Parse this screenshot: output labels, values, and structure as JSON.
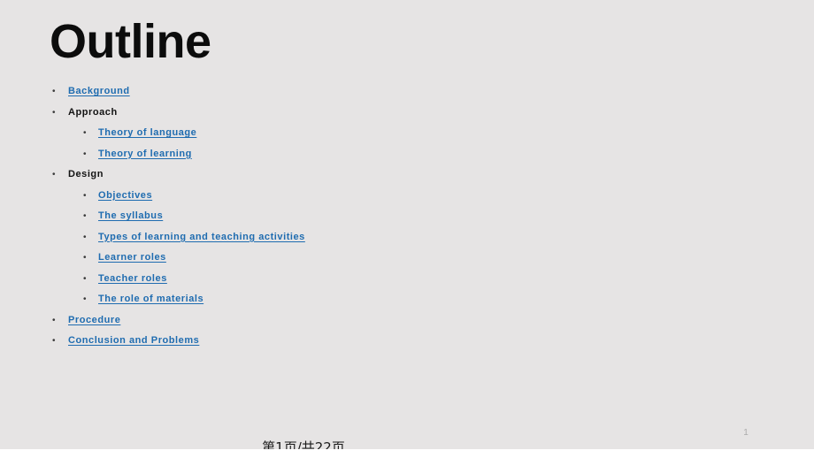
{
  "slide": {
    "title": "Outline",
    "background_color": "#e6e4e4",
    "title_color": "#0c0c0c",
    "link_color": "#1f6cb0",
    "plain_text_color": "#131313",
    "bullet_glyph": "•"
  },
  "outline": {
    "items": [
      {
        "label": "Background",
        "level": 1,
        "is_link": true
      },
      {
        "label": "Approach",
        "level": 1,
        "is_link": false
      },
      {
        "label": "Theory of language",
        "level": 2,
        "is_link": true
      },
      {
        "label": "Theory of learning",
        "level": 2,
        "is_link": true
      },
      {
        "label": "Design",
        "level": 1,
        "is_link": false
      },
      {
        "label": "Objectives",
        "level": 2,
        "is_link": true
      },
      {
        "label": "The syllabus",
        "level": 2,
        "is_link": true
      },
      {
        "label": "Types of learning and teaching activities",
        "level": 2,
        "is_link": true
      },
      {
        "label": "Learner roles",
        "level": 2,
        "is_link": true
      },
      {
        "label": "Teacher roles",
        "level": 2,
        "is_link": true
      },
      {
        "label": "The role of materials",
        "level": 2,
        "is_link": true
      },
      {
        "label": "Procedure",
        "level": 1,
        "is_link": true
      },
      {
        "label": "Conclusion and Problems",
        "level": 1,
        "is_link": true
      }
    ]
  },
  "footer": {
    "pager_text": "第1页/共22页",
    "page_number": "1",
    "page_number_color": "#ababab"
  }
}
